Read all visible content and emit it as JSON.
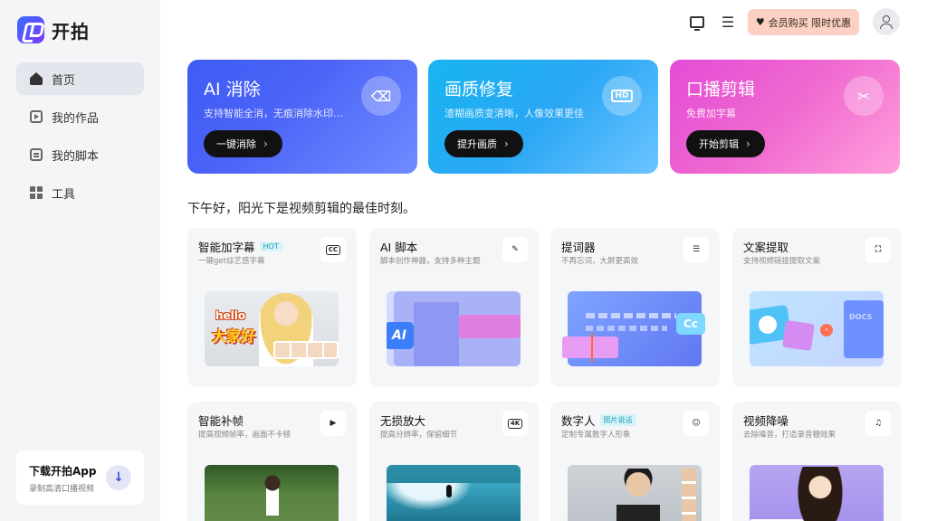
{
  "app": {
    "name": "开拍"
  },
  "sidebar": {
    "items": [
      {
        "label": "首页",
        "icon": "home-icon",
        "active": true
      },
      {
        "label": "我的作品",
        "icon": "works-icon",
        "active": false
      },
      {
        "label": "我的脚本",
        "icon": "script-icon",
        "active": false
      },
      {
        "label": "工具",
        "icon": "tools-icon",
        "active": false
      }
    ],
    "download": {
      "title": "下载开拍App",
      "subtitle": "录制高清口播视频"
    }
  },
  "header": {
    "icons": [
      "download-monitor-icon",
      "menu-icon"
    ],
    "vip_label": "会员购买 限时优惠",
    "accent": "#fcd1c3"
  },
  "banners": [
    {
      "title": "AI 消除",
      "subtitle": "支持智能全消，无痕消除水印…",
      "button": "一键消除",
      "icon": "eraser-icon"
    },
    {
      "title": "画质修复",
      "subtitle": "渣糊画质变清晰，人像效果更佳",
      "button": "提升画质",
      "icon": "hd-icon",
      "icon_text": "HD"
    },
    {
      "title": "口播剪辑",
      "subtitle": "免费加字幕",
      "button": "开始剪辑",
      "icon": "scissors-icon"
    }
  ],
  "greeting": "下午好，阳光下是视频剪辑的最佳时刻。",
  "tools": [
    {
      "title": "智能加字幕",
      "tag": "HOT",
      "subtitle": "一键get综艺感字幕",
      "icon": "cc-icon",
      "icon_text": "CC",
      "thumb_text": [
        "hello",
        "大家好"
      ]
    },
    {
      "title": "AI 脚本",
      "tag": "",
      "subtitle": "脚本创作神器，支持多种主题",
      "icon": "ai-script-icon",
      "icon_text": "✎",
      "thumb_text": [
        "AI"
      ]
    },
    {
      "title": "提词器",
      "tag": "",
      "subtitle": "不再忘词，大屏更高效",
      "icon": "teleprompter-icon",
      "icon_text": "☰",
      "thumb_text": [
        "Cc"
      ]
    },
    {
      "title": "文案提取",
      "tag": "",
      "subtitle": "支持视频链接提取文案",
      "icon": "extract-icon",
      "icon_text": "⛶",
      "thumb_text": [
        "DOCS"
      ]
    },
    {
      "title": "智能补帧",
      "tag": "",
      "subtitle": "提高视频帧率，画面不卡顿",
      "icon": "frame-icon",
      "icon_text": "▶"
    },
    {
      "title": "无损放大",
      "tag": "",
      "subtitle": "提高分辨率，保留细节",
      "icon": "4k-icon",
      "icon_text": "4K"
    },
    {
      "title": "数字人",
      "tag": "照片说话",
      "subtitle": "定制专属数字人形象",
      "icon": "digital-human-icon",
      "icon_text": "☺"
    },
    {
      "title": "视频降噪",
      "tag": "",
      "subtitle": "去除噪音，打造录音棚效果",
      "icon": "denoise-icon",
      "icon_text": "♫"
    }
  ]
}
